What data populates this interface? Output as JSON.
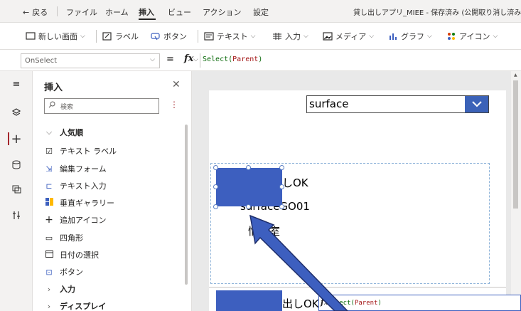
{
  "menubar": {
    "back": "戻る",
    "items": [
      "ファイル",
      "ホーム",
      "挿入",
      "ビュー",
      "アクション",
      "設定"
    ],
    "active_index": 2,
    "app_title": "貸し出しアプリ_MIEE - 保存済み (公開取り消し済み"
  },
  "ribbon": {
    "new_screen": "新しい画面",
    "label": "ラベル",
    "button": "ボタン",
    "text": "テキスト",
    "input": "入力",
    "media": "メディア",
    "chart": "グラフ",
    "icons": "アイコン"
  },
  "formula": {
    "property": "OnSelect",
    "equals": "=",
    "fx": "fx",
    "expression_func": "Select",
    "expression_arg": "Parent"
  },
  "insert_panel": {
    "title": "挿入",
    "search_placeholder": "検索",
    "section_popular": "人気順",
    "items": [
      "テキスト ラベル",
      "編集フォーム",
      "テキスト入力",
      "垂直ギャラリー",
      "追加アイコン",
      "四角形",
      "日付の選択",
      "ボタン"
    ],
    "section_input": "入力",
    "section_display": "ディスプレイ"
  },
  "canvas": {
    "dropdown_value": "surface",
    "gallery_row1": {
      "status": "出しOK",
      "name": "surfaceGO01",
      "dept": "情報室"
    },
    "gallery_row2_status": "出しOK",
    "popup_expression_func": "Select",
    "popup_expression_arg": "Parent"
  },
  "colors": {
    "accent_blue": "#3d5fbf",
    "dropdown_button": "#3b62b8",
    "rail_active": "#a4262c"
  }
}
